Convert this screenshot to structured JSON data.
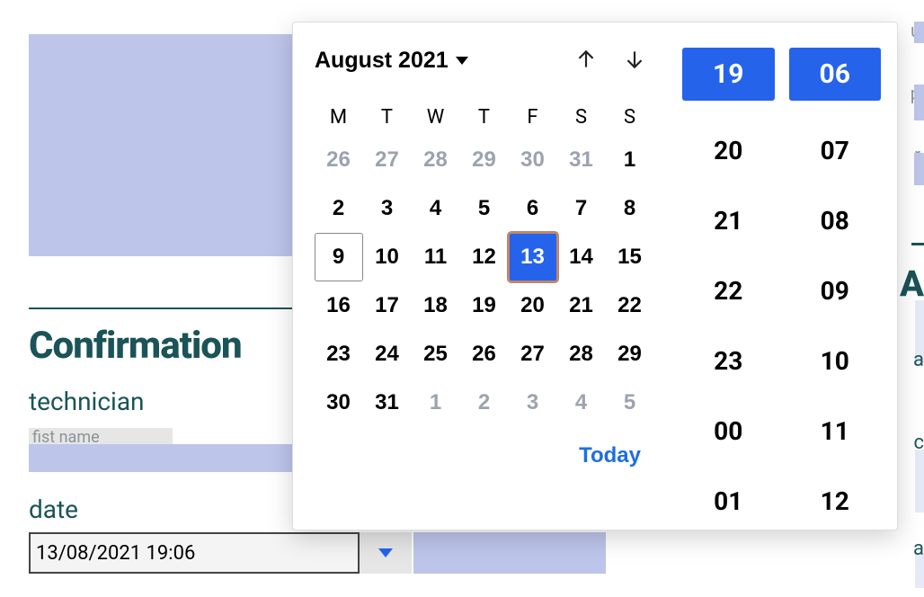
{
  "form": {
    "heading": "Confirmation",
    "technician_label": "technician",
    "first_name_label": "fist name",
    "date_label": "date",
    "date_value": "13/08/2021 19:06"
  },
  "picker": {
    "month_label": "August 2021",
    "today_label": "Today",
    "dow": [
      "M",
      "T",
      "W",
      "T",
      "F",
      "S",
      "S"
    ],
    "weeks": [
      [
        {
          "d": "26",
          "muted": true
        },
        {
          "d": "27",
          "muted": true
        },
        {
          "d": "28",
          "muted": true
        },
        {
          "d": "29",
          "muted": true
        },
        {
          "d": "30",
          "muted": true
        },
        {
          "d": "31",
          "muted": true
        },
        {
          "d": "1"
        }
      ],
      [
        {
          "d": "2"
        },
        {
          "d": "3"
        },
        {
          "d": "4"
        },
        {
          "d": "5"
        },
        {
          "d": "6"
        },
        {
          "d": "7"
        },
        {
          "d": "8"
        }
      ],
      [
        {
          "d": "9",
          "today": true
        },
        {
          "d": "10"
        },
        {
          "d": "11"
        },
        {
          "d": "12"
        },
        {
          "d": "13",
          "sel": true
        },
        {
          "d": "14"
        },
        {
          "d": "15"
        }
      ],
      [
        {
          "d": "16"
        },
        {
          "d": "17"
        },
        {
          "d": "18"
        },
        {
          "d": "19"
        },
        {
          "d": "20"
        },
        {
          "d": "21"
        },
        {
          "d": "22"
        }
      ],
      [
        {
          "d": "23"
        },
        {
          "d": "24"
        },
        {
          "d": "25"
        },
        {
          "d": "26"
        },
        {
          "d": "27"
        },
        {
          "d": "28"
        },
        {
          "d": "29"
        }
      ],
      [
        {
          "d": "30"
        },
        {
          "d": "31"
        },
        {
          "d": "1",
          "muted": true
        },
        {
          "d": "2",
          "muted": true
        },
        {
          "d": "3",
          "muted": true
        },
        {
          "d": "4",
          "muted": true
        },
        {
          "d": "5",
          "muted": true
        }
      ]
    ],
    "hours": [
      {
        "v": "19",
        "sel": true
      },
      {
        "v": "20"
      },
      {
        "v": "21"
      },
      {
        "v": "22"
      },
      {
        "v": "23"
      },
      {
        "v": "00"
      },
      {
        "v": "01"
      }
    ],
    "minutes": [
      {
        "v": "06",
        "sel": true
      },
      {
        "v": "07"
      },
      {
        "v": "08"
      },
      {
        "v": "09"
      },
      {
        "v": "10"
      },
      {
        "v": "11"
      },
      {
        "v": "12"
      }
    ]
  },
  "edge": {
    "bigA": "A",
    "l1": "u",
    "l2": "p",
    "l3": "r",
    "a1": "a",
    "a2": "c",
    "a3": "a"
  }
}
